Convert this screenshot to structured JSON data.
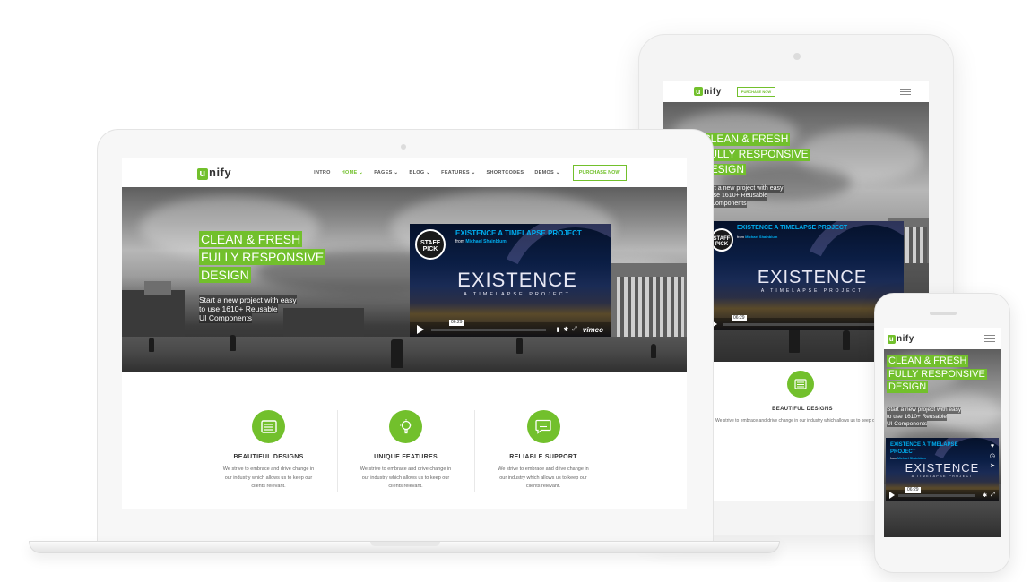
{
  "brand": {
    "logo_initial": "u",
    "logo_rest": "nify",
    "accent": "#72c02c",
    "video_accent": "#00adef"
  },
  "nav": {
    "items": [
      "INTRO",
      "HOME",
      "PAGES",
      "BLOG",
      "FEATURES",
      "SHORTCODES",
      "DEMOS"
    ],
    "active": "HOME"
  },
  "purchase_label": "PURCHASE NOW",
  "hero": {
    "line1": "CLEAN & FRESH",
    "line2": "FULLY RESPONSIVE",
    "line3": "DESIGN",
    "sub1": "Start a new project with easy",
    "sub2": "to use 1610+ Reusable",
    "sub3": "UI Components"
  },
  "video": {
    "title": "EXISTENCE A TIMELAPSE PROJECT",
    "from_prefix": "from",
    "author": "Michael Shainblum",
    "badge_small": "vimeo",
    "badge_line1": "STAFF",
    "badge_line2": "PICK",
    "big_title": "EXISTENCE",
    "big_sub": "A TIMELAPSE PROJECT",
    "time": "06:29",
    "logo": "vimeo"
  },
  "features": [
    {
      "icon": "newspaper-icon",
      "title": "BEAUTIFUL DESIGNS",
      "desc1": "We strive to embrace and drive change in",
      "desc2": "our industry which allows us to keep our",
      "desc3": "clients relevant."
    },
    {
      "icon": "lightbulb-icon",
      "title": "UNIQUE FEATURES",
      "desc1": "We strive to embrace and drive change in",
      "desc2": "our industry which allows us to keep our",
      "desc3": "clients relevant."
    },
    {
      "icon": "chat-bubble-icon",
      "title": "RELIABLE SUPPORT",
      "desc1": "We strive to embrace and drive change in",
      "desc2": "our industry which allows us to keep our",
      "desc3": "clients relevant."
    }
  ],
  "tablet": {
    "desc_single": "We strive to embrace and drive change in our industry which allows us to keep our"
  }
}
